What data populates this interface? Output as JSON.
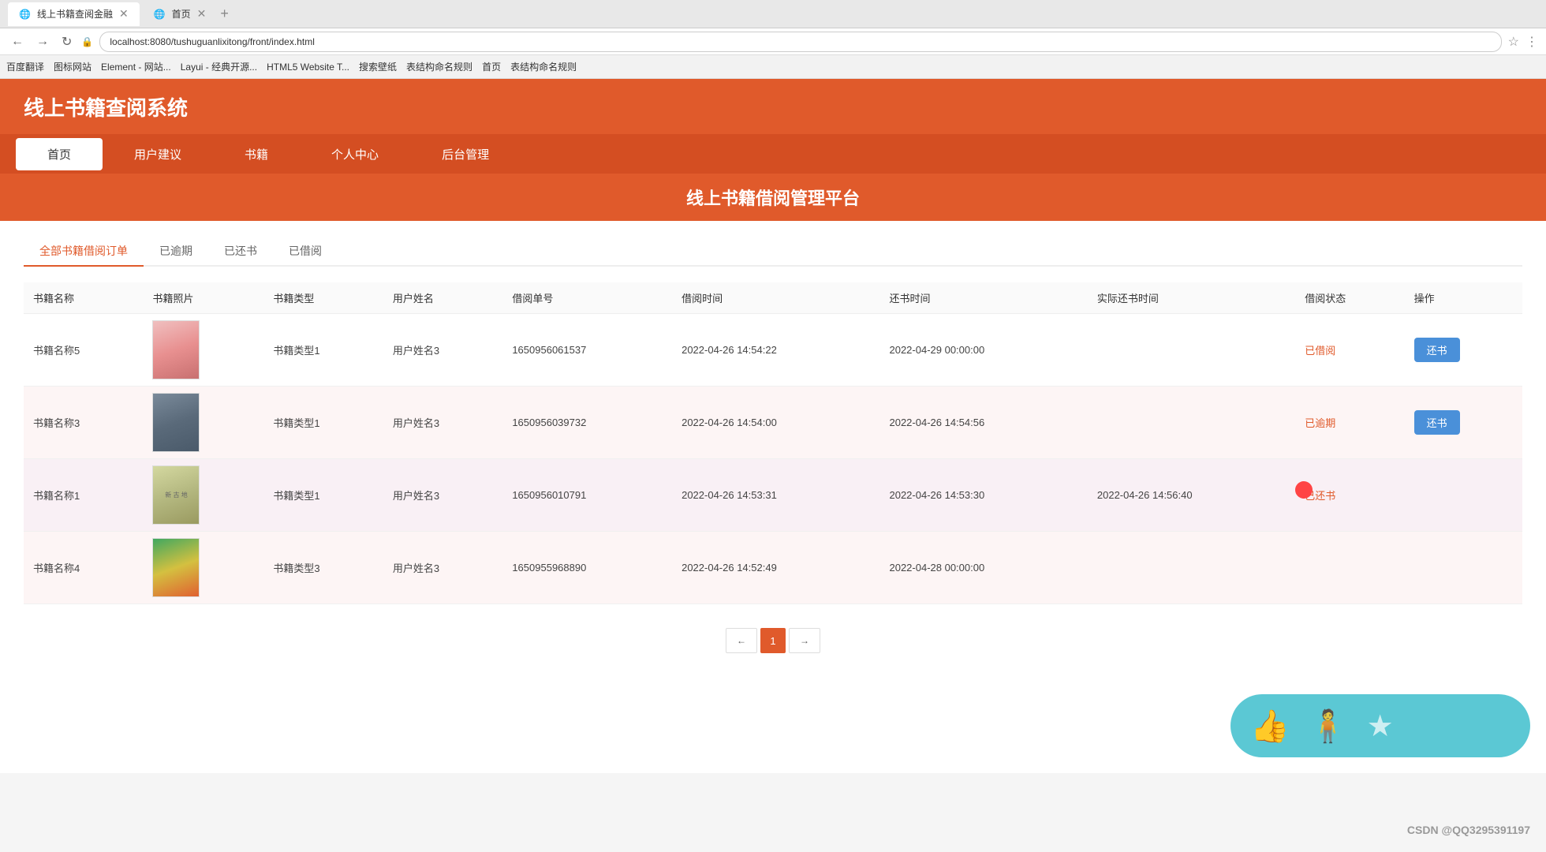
{
  "browser": {
    "tabs": [
      {
        "label": "线上书籍查阅金融",
        "active": true
      },
      {
        "label": "首页",
        "active": false
      }
    ],
    "url": "localhost:8080/tushuguanlixitong/front/index.html",
    "bookmarks": [
      "百度翻译",
      "图标网站",
      "Element - 网站...",
      "Layui - 经典开源...",
      "HTML5 Website T...",
      "搜索壁纸",
      "表结构命名规则",
      "首页",
      "表结构命名规则"
    ]
  },
  "header": {
    "title": "线上书籍查阅系统"
  },
  "nav": {
    "items": [
      {
        "label": "首页",
        "active": true
      },
      {
        "label": "用户建议",
        "active": false
      },
      {
        "label": "书籍",
        "active": false
      },
      {
        "label": "个人中心",
        "active": false
      },
      {
        "label": "后台管理",
        "active": false
      }
    ]
  },
  "banner": {
    "text": "线上书籍借阅管理平台"
  },
  "tabs": [
    {
      "label": "全部书籍借阅订单",
      "active": true
    },
    {
      "label": "已逾期",
      "active": false
    },
    {
      "label": "已还书",
      "active": false
    },
    {
      "label": "已借阅",
      "active": false
    }
  ],
  "table": {
    "headers": [
      "书籍名称",
      "书籍照片",
      "书籍类型",
      "用户姓名",
      "借阅单号",
      "借阅时间",
      "还书时间",
      "实际还书时间",
      "借阅状态",
      "操作"
    ],
    "rows": [
      {
        "name": "书籍名称5",
        "img_class": "book-cover-pink",
        "type": "书籍类型1",
        "user": "用户姓名3",
        "order_no": "1650956061537",
        "borrow_time": "2022-04-26 14:54:22",
        "return_time": "2022-04-29 00:00:00",
        "actual_return": "",
        "status": "已借阅",
        "status_class": "status-borrowed",
        "has_button": true,
        "button_label": "还书"
      },
      {
        "name": "书籍名称3",
        "img_class": "book-cover-dark",
        "type": "书籍类型1",
        "user": "用户姓名3",
        "order_no": "1650956039732",
        "borrow_time": "2022-04-26 14:54:00",
        "return_time": "2022-04-26 14:54:56",
        "actual_return": "",
        "status": "已逾期",
        "status_class": "status-overdue",
        "has_button": true,
        "button_label": "还书"
      },
      {
        "name": "书籍名称1",
        "img_class": "book-cover-text",
        "type": "书籍类型1",
        "user": "用户姓名3",
        "order_no": "1650956010791",
        "borrow_time": "2022-04-26 14:53:31",
        "return_time": "2022-04-26 14:53:30",
        "actual_return": "2022-04-26 14:56:40",
        "status": "已还书",
        "status_class": "status-returned",
        "has_button": false,
        "button_label": ""
      },
      {
        "name": "书籍名称4",
        "img_class": "book-cover-bright",
        "type": "书籍类型3",
        "user": "用户姓名3",
        "order_no": "1650955968890",
        "borrow_time": "2022-04-26 14:52:49",
        "return_time": "2022-04-28 00:00:00",
        "actual_return": "",
        "status": "",
        "status_class": "",
        "has_button": false,
        "button_label": ""
      }
    ]
  },
  "pagination": {
    "prev_label": "←",
    "next_label": "→",
    "current": 1,
    "pages": [
      1
    ]
  },
  "social_widget": {
    "thumbs_up": "👍",
    "person": "🧍",
    "star": "★"
  },
  "watermark": "CSDN @QQ3295391197"
}
